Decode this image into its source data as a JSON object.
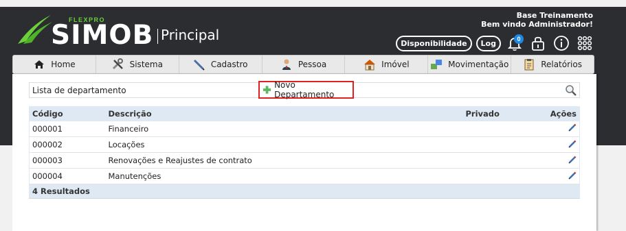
{
  "brand": {
    "flexpro": "FLEXPRO",
    "name": "SIMOB",
    "section": "Principal"
  },
  "user": {
    "line1": "Base Treinamento",
    "line2": "Bem vindo Administrador!"
  },
  "top_actions": {
    "disponibilidade": "Disponibilidade",
    "log": "Log",
    "notifications_count": "0"
  },
  "menu": [
    {
      "label": "Home",
      "icon": "home-icon"
    },
    {
      "label": "Sistema",
      "icon": "tools-icon"
    },
    {
      "label": "Cadastro",
      "icon": "pencil-icon"
    },
    {
      "label": "Pessoa",
      "icon": "person-icon"
    },
    {
      "label": "Imóvel",
      "icon": "house-icon"
    },
    {
      "label": "Movimentação",
      "icon": "exchange-icon"
    },
    {
      "label": "Relatórios",
      "icon": "clipboard-icon"
    }
  ],
  "list": {
    "title": "Lista de departamento",
    "new_button": "Novo Departamento",
    "columns": {
      "codigo": "Código",
      "descricao": "Descrição",
      "privado": "Privado",
      "acoes": "Ações"
    },
    "rows": [
      {
        "codigo": "000001",
        "descricao": "Financeiro",
        "privado": ""
      },
      {
        "codigo": "000002",
        "descricao": "Locações",
        "privado": ""
      },
      {
        "codigo": "000003",
        "descricao": "Renovações e Reajustes de contrato",
        "privado": ""
      },
      {
        "codigo": "000004",
        "descricao": "Manutenções",
        "privado": ""
      }
    ],
    "results": "4 Resultados"
  },
  "colors": {
    "header_bg": "#2b2d30",
    "brand_green": "#6bd13a",
    "highlight_red": "#e02020",
    "table_header_bg": "#dfe9f3"
  }
}
